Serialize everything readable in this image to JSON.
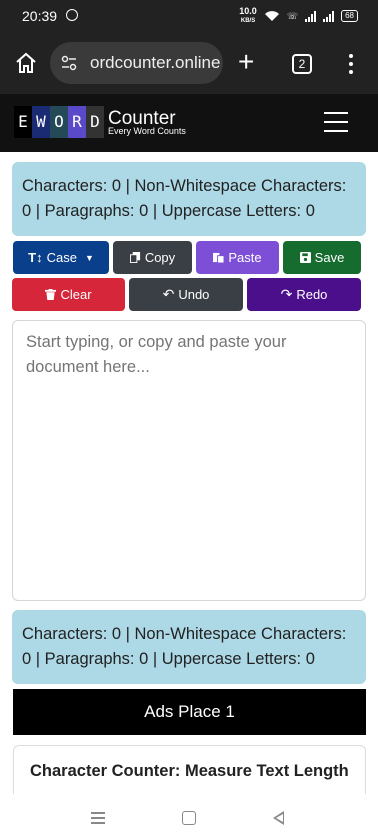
{
  "status_bar": {
    "time": "20:39",
    "net_speed": "10.0",
    "net_unit": "KB/S",
    "battery": "68"
  },
  "browser": {
    "url": "ordcounter.online",
    "tab_count": "2"
  },
  "site": {
    "logo_letters": [
      "E",
      "W",
      "O",
      "R",
      "D"
    ],
    "logo_word": "Counter",
    "tagline": "Every Word Counts"
  },
  "stats_top": "Characters: 0 | Non-Whitespace Characters: 0 | Paragraphs: 0 | Uppercase Letters: 0",
  "toolbar": {
    "case": "Case",
    "copy": "Copy",
    "paste": "Paste",
    "save": "Save",
    "clear": "Clear",
    "undo": "Undo",
    "redo": "Redo"
  },
  "editor": {
    "placeholder": "Start typing, or copy and paste your document here...",
    "value": ""
  },
  "stats_bottom": "Characters: 0 | Non-Whitespace Characters: 0 | Paragraphs: 0 | Uppercase Letters: 0",
  "ads_label": "Ads Place 1",
  "section_title": "Character Counter: Measure Text Length",
  "colors": {
    "stats_bg": "#add8e6",
    "case_btn": "#0a3f8c",
    "paste_btn": "#7d4fd6",
    "save_btn": "#166b2f",
    "clear_btn": "#d6263a",
    "redo_btn": "#4b0f8c"
  }
}
